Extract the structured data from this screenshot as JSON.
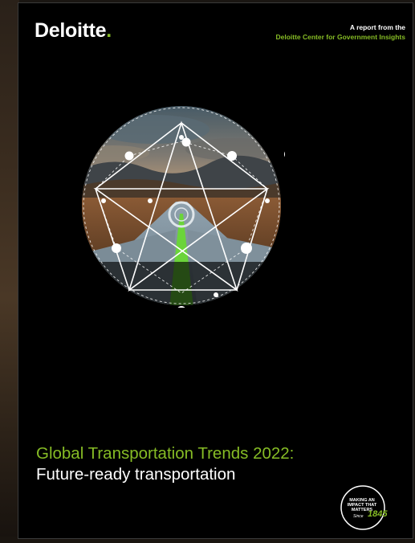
{
  "brand": {
    "name": "Deloitte",
    "dot": ".",
    "accent_color": "#86bc25"
  },
  "header": {
    "report_line1": "A report from the",
    "report_line2": "Deloitte Center for Government Insights"
  },
  "title": {
    "line1": "Global Transportation Trends 2022:",
    "line2": "Future-ready transportation"
  },
  "badge": {
    "text": "MAKING AN IMPACT THAT MATTERS",
    "since": "Since",
    "number": "1845"
  },
  "artwork": {
    "description_icon": "road-pentagram-illustration"
  }
}
